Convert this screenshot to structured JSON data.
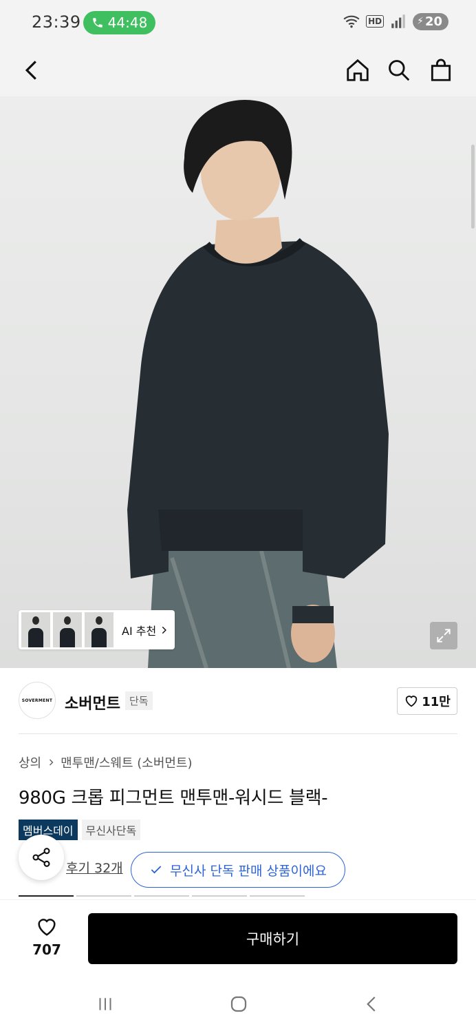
{
  "status_bar": {
    "time": "23:39",
    "call_duration": "44:48",
    "hd_label": "HD",
    "battery": "20",
    "icons": [
      "phone-icon",
      "wifi-icon",
      "signal-icon",
      "battery-icon"
    ]
  },
  "header": {
    "icons": [
      "back-icon",
      "home-icon",
      "search-icon",
      "bag-icon"
    ]
  },
  "gallery": {
    "ai_recommend_label": "AI 추천"
  },
  "brand": {
    "logo_text": "SOVERMENT",
    "name": "소버먼트",
    "tag": "단독",
    "like_count": "11만"
  },
  "product": {
    "breadcrumb": [
      "상의",
      "맨투맨/스웨트 (소버먼트)"
    ],
    "title": "980G 크롭 피그먼트 맨투맨-워시드 블랙-",
    "tags": [
      "멤버스데이",
      "무신사단독"
    ],
    "review_link": "후기 32개",
    "exclusive_pill": "무신사 단독 판매 상품이에요"
  },
  "bottom_bar": {
    "wish_count": "707",
    "buy_label": "구매하기"
  },
  "colors": {
    "accent_blue": "#2b64d6",
    "member_tag_bg": "#0c3a5e",
    "call_green": "#3fbf5f"
  }
}
